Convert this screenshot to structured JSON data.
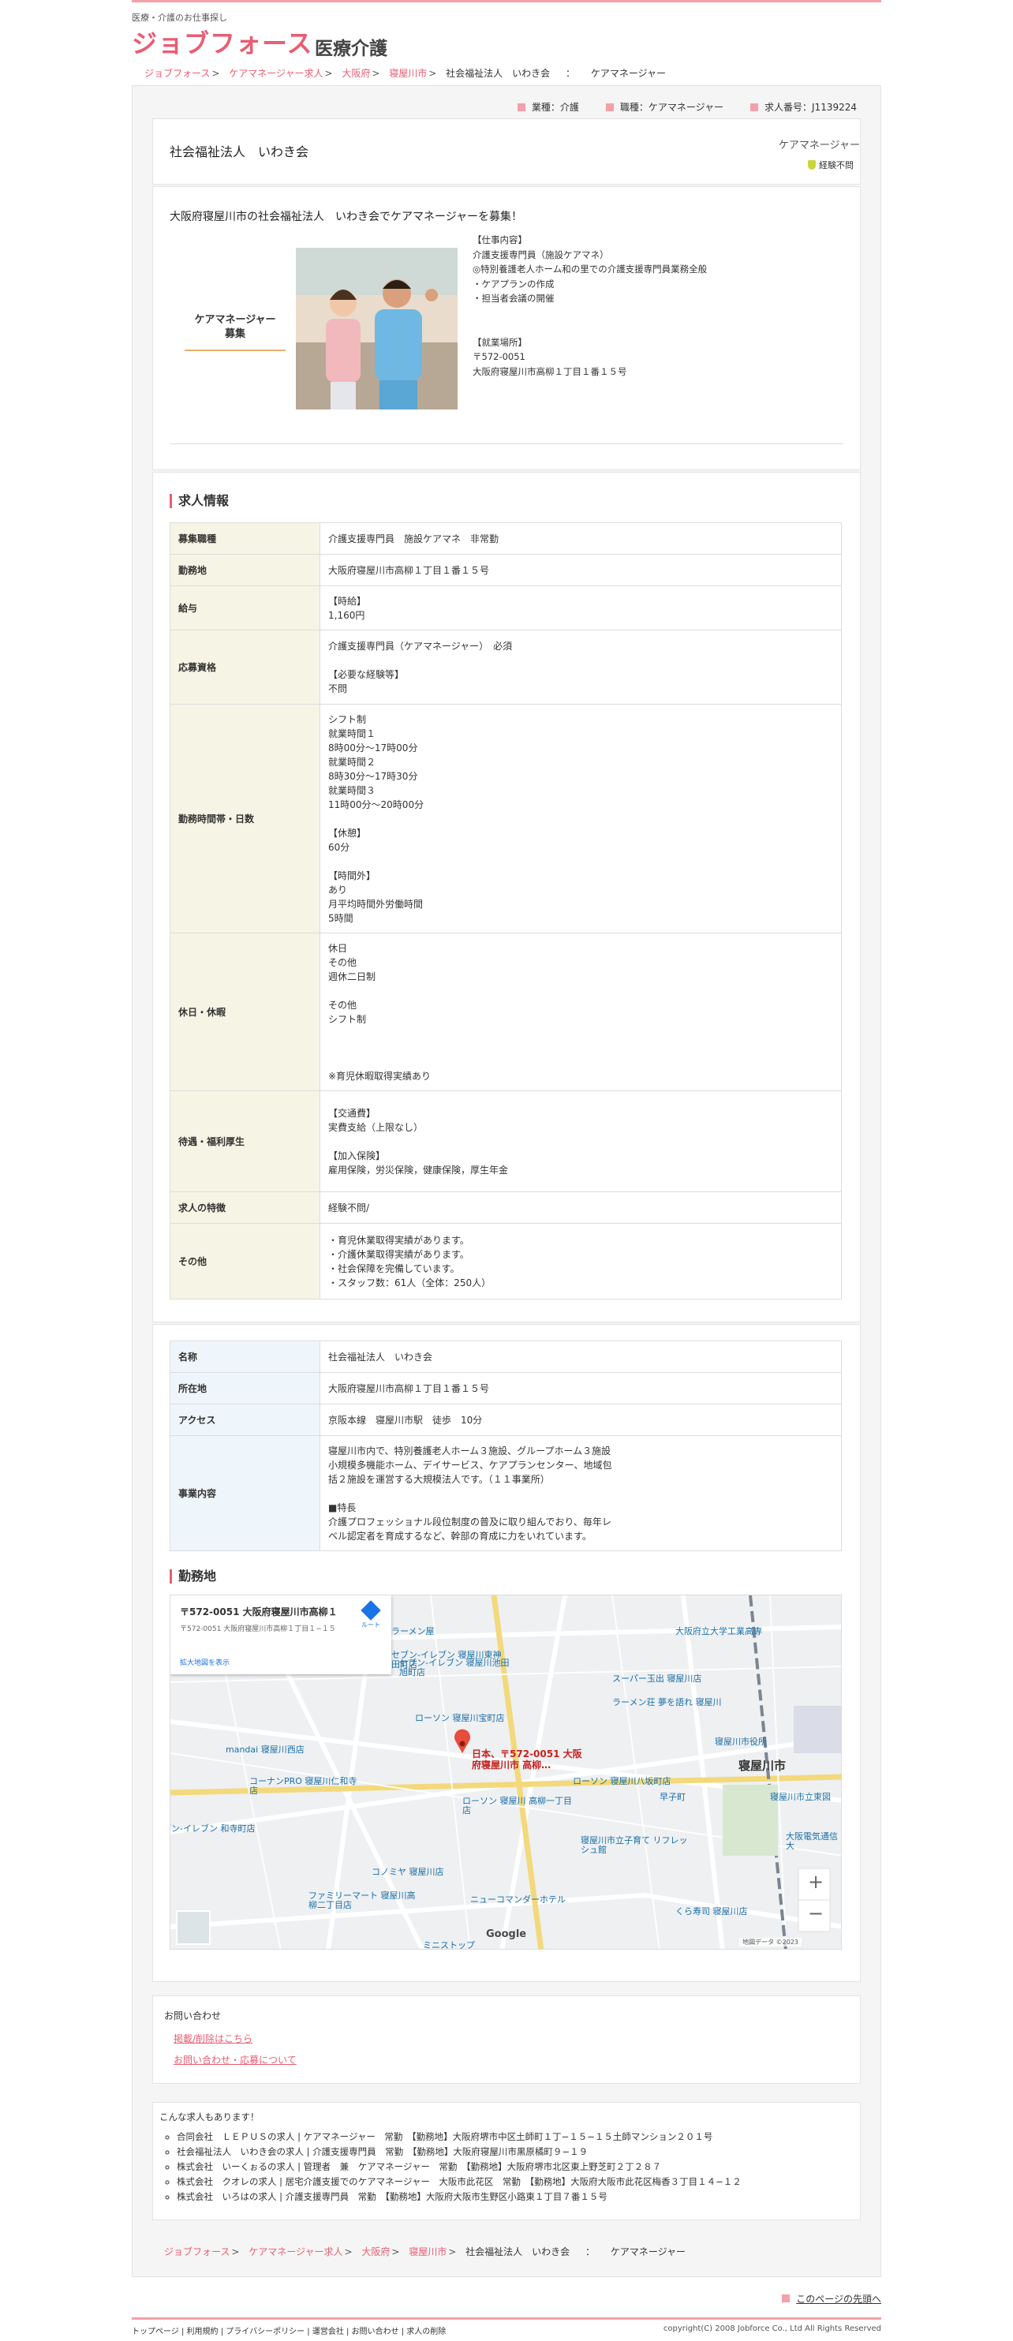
{
  "header": {
    "tagline": "医療・介護のお仕事探し",
    "logo": "ジョブフォース",
    "logo_sub": "医療介護"
  },
  "breadcrumb": {
    "items": [
      "ジョブフォース",
      "ケアマネージャー求人",
      "大阪府",
      "寝屋川市"
    ],
    "current": "社会福祉法人　いわき会",
    "sep": "：",
    "job": "ケアマネージャー"
  },
  "meta": {
    "industry": "業種：介護",
    "occupation": "職種：ケアマネージャー",
    "job_id": "求人番号：J1139224"
  },
  "company": {
    "name": "社会福祉法人　いわき会",
    "job": "ケアマネージャー",
    "badge": "経験不問"
  },
  "intro": {
    "headline": "大阪府寝屋川市の社会福祉法人　いわき会でケアマネージャーを募集！",
    "label_line1": "ケアマネージャー",
    "label_line2": "募集",
    "photo_label": "staff-photo",
    "desc": "【仕事内容】\n介護支援専門員（施設ケアマネ）\n◎特別養護老人ホーム和の里での介護支援専門員業務全般\n・ケアプランの作成\n・担当者会議の開催\n\n\n【就業場所】\n〒572-0051\n大阪府寝屋川市高柳１丁目１番１５号"
  },
  "job_info": {
    "title": "求人情報",
    "rows": [
      {
        "k": "募集職種",
        "v": "介護支援専門員　施設ケアマネ　非常勤"
      },
      {
        "k": "勤務地",
        "v": "大阪府寝屋川市高柳１丁目１番１５号"
      },
      {
        "k": "給与",
        "v": "【時給】\n1,160円"
      },
      {
        "k": "応募資格",
        "v": "介護支援専門員（ケアマネージャー）　必須\n\n【必要な経験等】\n不問"
      },
      {
        "k": "勤務時間帯・日数",
        "v": "シフト制\n就業時間１\n8時00分～17時00分\n就業時間２\n8時30分～17時30分\n就業時間３\n11時00分～20時00分\n\n【休憩】\n60分\n\n【時間外】\nあり\n月平均時間外労働時間\n5時間"
      },
      {
        "k": "休日・休暇",
        "v": "休日\nその他\n週休二日制\n\nその他\nシフト制\n\n\n\n※育児休暇取得実績あり"
      },
      {
        "k": "待遇・福利厚生",
        "v": "【交通費】\n実費支給（上限なし）\n\n【加入保険】\n雇用保険，労災保険，健康保険，厚生年金"
      },
      {
        "k": "求人の特徴",
        "v": "経験不問/"
      },
      {
        "k": "その他",
        "v": "・育児休業取得実績があります。\n・介護休業取得実績があります。\n・社会保障を完備しています。\n・スタッフ数：61人（全体：250人）"
      }
    ]
  },
  "company_info": {
    "rows": [
      {
        "k": "名称",
        "v": "社会福祉法人　いわき会"
      },
      {
        "k": "所在地",
        "v": "大阪府寝屋川市高柳１丁目１番１５号"
      },
      {
        "k": "アクセス",
        "v": "京阪本線　寝屋川市駅　徒歩　10分"
      },
      {
        "k": "事業内容",
        "v": "寝屋川市内で、特別養護老人ホーム３施設、グループホーム３施設\n小規模多機能ホーム、デイサービス、ケアプランセンター、地域包\n括２施設を運営する大規模法人です。（１１事業所）\n\n■特長\n介護プロフェッショナル段位制度の普及に取り組んでおり、毎年レ\nベル認定者を育成するなど、幹部の育成に力をいれています。"
      }
    ]
  },
  "map": {
    "title": "勤務地",
    "card_title": "〒572-0051 大阪府寝屋川市高柳１丁目１−１５",
    "card_sub": "〒572-0051 大阪府寝屋川市高柳１丁目１−１５",
    "card_link": "拡大地図を表示",
    "route": "ルート",
    "pin_label": "日本、〒572-0051 大阪府寝屋川市 高柳…",
    "google": "Google",
    "zoom_in": "+",
    "zoom_out": "−",
    "copyright": "地図データ ©2023",
    "labels": [
      {
        "t": "寝屋川市",
        "kind": "city"
      },
      {
        "t": "大阪府立大学工業高専",
        "kind": "poi"
      },
      {
        "t": "スーパー玉出 寝屋川店",
        "kind": "poi"
      },
      {
        "t": "ラーメン屋",
        "kind": "poi"
      },
      {
        "t": "セブン-イレブン 寝屋川池田旭町店",
        "kind": "poi"
      },
      {
        "t": "ローソン 寝屋川宝町店",
        "kind": "poi"
      },
      {
        "t": "mandai 寝屋川西店",
        "kind": "poi"
      },
      {
        "t": "コーナンPRO 寝屋川仁和寺店",
        "kind": "poi"
      },
      {
        "t": "ローソン 寝屋川八坂町店",
        "kind": "poi"
      },
      {
        "t": "ローソン 寝屋川 高柳一丁目店",
        "kind": "poi"
      },
      {
        "t": "寝屋川市役所",
        "kind": "poi"
      },
      {
        "t": "寝屋川市立東図",
        "kind": "poi"
      },
      {
        "t": "寝屋川市立子育て リフレッシュ館",
        "kind": "poi"
      },
      {
        "t": "コノミヤ 寝屋川店",
        "kind": "poi"
      },
      {
        "t": "ファミリーマート 寝屋川高柳二丁目店",
        "kind": "poi"
      },
      {
        "t": "ニューコマンダーホテル",
        "kind": "poi"
      },
      {
        "t": "くら寿司 寝屋川店",
        "kind": "poi"
      },
      {
        "t": "セブン-イレブン 寝屋川東神田町店",
        "kind": "poi"
      },
      {
        "t": "ブン-イレブン 和寺町店",
        "kind": "poi"
      },
      {
        "t": "大阪電気通信大",
        "kind": "poi"
      },
      {
        "t": "ミニストップ",
        "kind": "poi"
      },
      {
        "t": "ラーメン荘 夢を語れ 寝屋川",
        "kind": "poi"
      },
      {
        "t": "早子町",
        "kind": "area"
      }
    ]
  },
  "contact": {
    "title": "お問い合わせ",
    "link1": "掲載/削除はこちら",
    "link2": "お問い合わせ・応募について"
  },
  "others": {
    "title": "こんな求人もあります！",
    "items": [
      "合同会社　ＬＥＰＵＳの求人 | ケアマネージャー　常勤　【勤務地】大阪府堺市中区土師町１丁−１５−１５土師マンション２０１号",
      "社会福祉法人　いわき会の求人 | 介護支援専門員　常勤　【勤務地】大阪府寝屋川市黒原橘町９−１９",
      "株式会社　いーくぉるの求人 | 管理者　兼　ケアマネージャー　常勤　【勤務地】大阪府堺市北区東上野芝町２丁２８７",
      "株式会社　クオレの求人 | 居宅介護支援でのケアマネージャー　大阪市此花区　常勤　【勤務地】大阪府大阪市此花区梅香３丁目１４−１２",
      "株式会社　いろはの求人 | 介護支援専門員　常勤　【勤務地】大阪府大阪市生野区小路東１丁目７番１５号"
    ]
  },
  "pagetop": "このページの先頭へ",
  "footer": {
    "links": [
      "トップページ",
      "利用規約",
      "プライバシーポリシー",
      "運営会社",
      "お問い合わせ",
      "求人の削除"
    ],
    "copyright": "copyright(C) 2008 Jobforce Co., Ltd All Rights Reserved"
  }
}
